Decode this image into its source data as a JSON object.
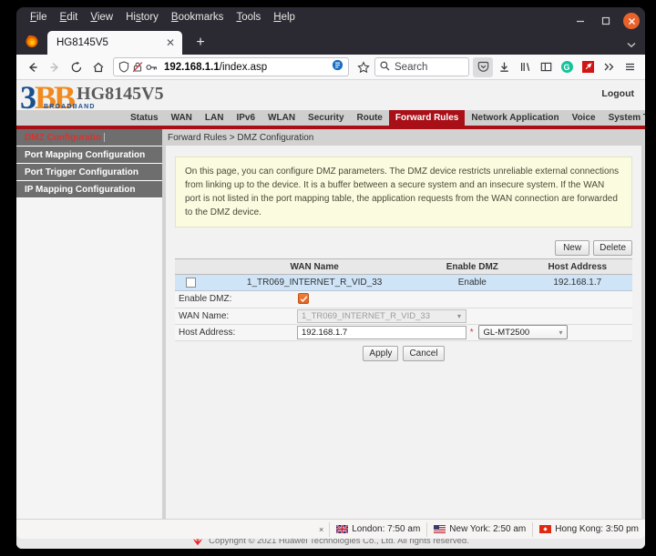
{
  "browser": {
    "menu": [
      {
        "label": "File",
        "accel": "F"
      },
      {
        "label": "Edit",
        "accel": "E"
      },
      {
        "label": "View",
        "accel": "V"
      },
      {
        "label": "History",
        "accel": "s"
      },
      {
        "label": "Bookmarks",
        "accel": "B"
      },
      {
        "label": "Tools",
        "accel": "T"
      },
      {
        "label": "Help",
        "accel": "H"
      }
    ],
    "window_controls": {
      "minimize": "–",
      "maximize": "☐",
      "close": "✕"
    },
    "tab": {
      "title": "HG8145V5",
      "close": "✕",
      "new_tab": "+",
      "list_all_tabs": "⌄"
    },
    "nav": {
      "back": "←",
      "forward": "→",
      "reload": "⟳",
      "home": "⌂",
      "url_host": "192.168.1.1",
      "url_path": "/index.asp",
      "shield_icon": "shield-icon",
      "lock_broken_icon": "lock-crossed-icon",
      "permissions_key_icon": "key-icon",
      "reader_icon": "reader-view-icon",
      "bookmark_star": "☆"
    },
    "search": {
      "placeholder": "Search",
      "icon": "search-icon"
    },
    "toolbar_icons": [
      {
        "name": "pocket-icon",
        "glyph": "♡"
      },
      {
        "name": "downloads-icon",
        "glyph": "↓"
      },
      {
        "name": "library-icon",
        "glyph": "‖∖"
      },
      {
        "name": "sidebar-icon",
        "glyph": "◫"
      },
      {
        "name": "grammarly-extension-icon",
        "glyph": "G",
        "color": "#15c39a"
      },
      {
        "name": "red-extension-icon",
        "glyph": "➶",
        "color": "#d21414"
      },
      {
        "name": "overflow-icon",
        "glyph": "»"
      },
      {
        "name": "app-menu-icon",
        "glyph": "≡"
      }
    ]
  },
  "router": {
    "brand": {
      "logo_digit": "3",
      "logo_letters": "BB",
      "logo_subtitle": "BROADBAND",
      "device_model": "HG8145V5",
      "logout_label": "Logout",
      "accent_red": "#a90f17",
      "accent_blue": "#1a4f8f",
      "accent_orange": "#f08a1e"
    },
    "nav_tabs": [
      {
        "label": "Status",
        "active": false
      },
      {
        "label": "WAN",
        "active": false
      },
      {
        "label": "LAN",
        "active": false
      },
      {
        "label": "IPv6",
        "active": false
      },
      {
        "label": "WLAN",
        "active": false
      },
      {
        "label": "Security",
        "active": false
      },
      {
        "label": "Route",
        "active": false
      },
      {
        "label": "Forward Rules",
        "active": true
      },
      {
        "label": "Network Application",
        "active": false
      },
      {
        "label": "Voice",
        "active": false
      },
      {
        "label": "System Tools",
        "active": false
      }
    ],
    "sidebar": [
      {
        "label": "DMZ Configuratio",
        "active": true
      },
      {
        "label": "Port Mapping Configuration",
        "active": false
      },
      {
        "label": "Port Trigger Configuration",
        "active": false
      },
      {
        "label": "IP Mapping Configuration",
        "active": false
      }
    ],
    "breadcrumb": "Forward Rules > DMZ Configuration",
    "info_text": "On this page, you can configure DMZ parameters. The DMZ device restricts unreliable external connections from linking up to the device. It is a buffer between a secure system and an insecure system. If the WAN port is not listed in the port mapping table, the application requests from the WAN connection are forwarded to the DMZ device.",
    "table_actions": {
      "new_label": "New",
      "delete_label": "Delete"
    },
    "table": {
      "columns": [
        "",
        "WAN Name",
        "Enable DMZ",
        "Host Address"
      ],
      "rows": [
        {
          "selected": false,
          "wan_name": "1_TR069_INTERNET_R_VID_33",
          "enable_dmz": "Enable",
          "host_address": "192.168.1.7"
        }
      ]
    },
    "form": {
      "enable_dmz_label": "Enable DMZ:",
      "enable_dmz_checked": true,
      "enable_dmz_check_glyph": "✔",
      "wan_name_label": "WAN Name:",
      "wan_name_value": "1_TR069_INTERNET_R_VID_33",
      "wan_name_disabled": true,
      "host_address_label": "Host Address:",
      "host_address_value": "192.168.1.7",
      "required_marker": "*",
      "device_select_value": "GL-MT2500",
      "dropdown_arrow": "▾",
      "apply_label": "Apply",
      "cancel_label": "Cancel"
    },
    "footer": {
      "copyright": "Copyright © 2021 Huawei Technologies Co., Ltd. All rights reserved.",
      "logo_name": "huawei-logo"
    }
  },
  "statusbar": {
    "close_glyph": "×",
    "clocks": [
      {
        "city": "London",
        "time": "7:50 am",
        "flag": "uk-flag-icon"
      },
      {
        "city": "New York",
        "time": "2:50 am",
        "flag": "us-flag-icon"
      },
      {
        "city": "Hong Kong",
        "time": "3:50 pm",
        "flag": "hk-flag-icon"
      }
    ]
  }
}
